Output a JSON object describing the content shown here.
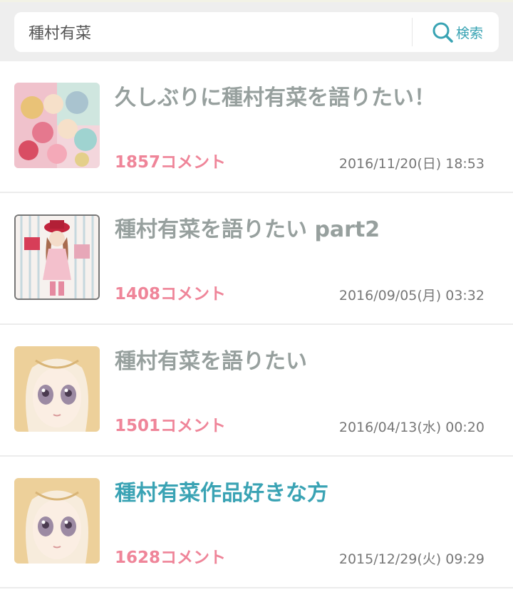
{
  "search": {
    "query": "種村有菜",
    "button_label": "検索"
  },
  "colors": {
    "accent": "#38a3b3",
    "title": "#97a09e",
    "comment": "#ef8599",
    "date": "#777777"
  },
  "threads": [
    {
      "title": "久しぶりに種村有菜を語りたい！",
      "comments": "1857コメント",
      "date": "2016/11/20(日) 18:53",
      "thumbnail": "manga-group-illustration",
      "highlighted": false
    },
    {
      "title": "種村有菜を語りたい part2",
      "comments": "1408コメント",
      "date": "2016/09/05(月) 03:32",
      "thumbnail": "manga-girl-with-hat-illustration",
      "highlighted": false
    },
    {
      "title": "種村有菜を語りたい",
      "comments": "1501コメント",
      "date": "2016/04/13(水) 00:20",
      "thumbnail": "manga-girl-portrait",
      "highlighted": false
    },
    {
      "title": "種村有菜作品好きな方",
      "comments": "1628コメント",
      "date": "2015/12/29(火) 09:29",
      "thumbnail": "manga-girl-portrait",
      "highlighted": true
    }
  ]
}
